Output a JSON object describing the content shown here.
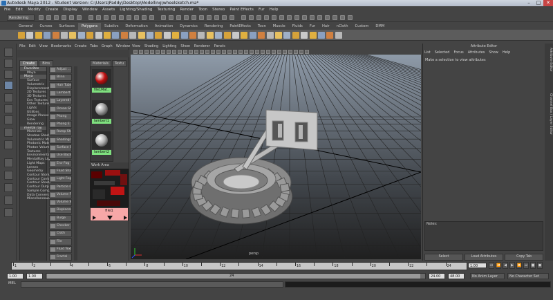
{
  "window": {
    "title": "Autodesk Maya 2012 - Student Version: C:\\Users\\Paddy\\Desktop\\Modelling\\wheelsketch.ma*",
    "min": "–",
    "max": "□",
    "close": "✕"
  },
  "menu": [
    "File",
    "Edit",
    "Modify",
    "Create",
    "Display",
    "Window",
    "Assets",
    "Lighting/Shading",
    "Texturing",
    "Render",
    "Toon",
    "Stereo",
    "Paint Effects",
    "Fur",
    "Help"
  ],
  "status": {
    "mode": "Rendering"
  },
  "shelf": {
    "tabs": [
      "General",
      "Curves",
      "Surfaces",
      "Polygons",
      "Subdivs",
      "Deformation",
      "Animation",
      "Dynamics",
      "Rendering",
      "PaintEffects",
      "Toon",
      "Muscle",
      "Fluids",
      "Fur",
      "Hair",
      "nCloth",
      "Custom",
      "DMM"
    ],
    "active": 3
  },
  "hypershade": {
    "menu": [
      "File",
      "Edit",
      "View",
      "Bookmarks",
      "Create",
      "Tabs",
      "Graph",
      "Window"
    ],
    "create_tabs": [
      "Create",
      "Bins"
    ],
    "tree": [
      {
        "t": "sec",
        "label": "Favorites"
      },
      {
        "t": "it",
        "label": "Maya"
      },
      {
        "t": "sec",
        "label": "Maya"
      },
      {
        "t": "it",
        "label": "Surface"
      },
      {
        "t": "it",
        "label": "Volumetric"
      },
      {
        "t": "it",
        "label": "Displacement"
      },
      {
        "t": "it",
        "label": "2D Textures"
      },
      {
        "t": "it",
        "label": "3D Textures"
      },
      {
        "t": "it",
        "label": "Env Textures"
      },
      {
        "t": "it",
        "label": "Other Textures"
      },
      {
        "t": "it",
        "label": "Lights"
      },
      {
        "t": "it",
        "label": "Utilities"
      },
      {
        "t": "it",
        "label": "Image Planes"
      },
      {
        "t": "it",
        "label": "Glow"
      },
      {
        "t": "it",
        "label": "Rendering"
      },
      {
        "t": "sec",
        "label": "mental ray"
      },
      {
        "t": "it",
        "label": "Materials"
      },
      {
        "t": "it",
        "label": "Shadow Shad"
      },
      {
        "t": "it",
        "label": "Volumetric Ma"
      },
      {
        "t": "it",
        "label": "Photonic Mate"
      },
      {
        "t": "it",
        "label": "Photon Volum"
      },
      {
        "t": "it",
        "label": "Textures"
      },
      {
        "t": "it",
        "label": "Environments"
      },
      {
        "t": "it",
        "label": "MentalRay Lig"
      },
      {
        "t": "it",
        "label": "Light Maps"
      },
      {
        "t": "it",
        "label": "Lenses"
      },
      {
        "t": "it",
        "label": "Geometry"
      },
      {
        "t": "it",
        "label": "Contour Store"
      },
      {
        "t": "it",
        "label": "Contour Contr"
      },
      {
        "t": "it",
        "label": "Contour Shade"
      },
      {
        "t": "it",
        "label": "Contour Outpu"
      },
      {
        "t": "it",
        "label": "Sample Comp"
      },
      {
        "t": "it",
        "label": "Data Conversi"
      },
      {
        "t": "it",
        "label": "Miscellaneous"
      }
    ],
    "nodes": [
      "Adjust ...",
      "Blinn",
      "Hair Tube",
      "Lambert",
      "Layered Sh",
      "Ocean Sha",
      "Phong",
      "Phong E",
      "Ramp Sha",
      "Shading M",
      "Surface Sh",
      "Use Backgr",
      "Env Fog",
      "Fluid Shape",
      "Light Fog",
      "Particle Cl",
      "Volume Fog",
      "Volume Sha",
      "Displacem",
      "Bulge",
      "Checker",
      "Cloth",
      "File",
      "Fluid Textu",
      "Fractal"
    ],
    "mat_tabs": [
      "Materials",
      "Textu"
    ],
    "materials": [
      {
        "name": "file1Mat..",
        "color": "#c01010"
      },
      {
        "name": "lambert1",
        "color": "#9a9a9a"
      },
      {
        "name": "lambert2",
        "color": "#b0b0b0"
      }
    ],
    "work_area": "Work Area",
    "file_node": "file1"
  },
  "viewport": {
    "menu": [
      "View",
      "Shading",
      "Lighting",
      "Show",
      "Renderer",
      "Panels"
    ],
    "camera": "persp"
  },
  "attr": {
    "title": "Attribute Editor",
    "menu": [
      "List",
      "Selected",
      "Focus",
      "Attributes",
      "Show",
      "Help"
    ],
    "message": "Make a selection to view attributes",
    "notes": "Notes:",
    "buttons": [
      "Select",
      "Load Attributes",
      "Copy Tab"
    ],
    "side_tabs": [
      "Attribute Editor",
      "Channel Box / Layer Editor"
    ]
  },
  "timeline": {
    "ticks": [
      1,
      2,
      3,
      4,
      5,
      6,
      7,
      8,
      9,
      10,
      11,
      12,
      13,
      14,
      15,
      16,
      17,
      18,
      19,
      20,
      21,
      22,
      23,
      24
    ],
    "current": "1.00"
  },
  "range": {
    "start": "1.00",
    "inner_start": "1.00",
    "display": "24",
    "inner_end": "24.00",
    "end": "48.00",
    "anim_layer": "No Anim Layer",
    "char_set": "No Character Set"
  },
  "cmd": {
    "label": "MEL"
  }
}
